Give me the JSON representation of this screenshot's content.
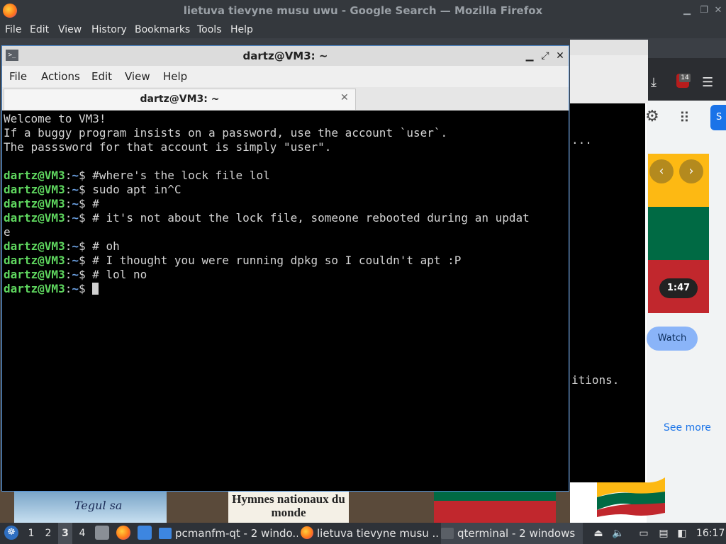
{
  "firefox": {
    "window_title": "lietuva tievyne musu uwu - Google Search — Mozilla Firefox",
    "menu": [
      "File",
      "Edit",
      "View",
      "History",
      "Bookmarks",
      "Tools",
      "Help"
    ],
    "ublock_count": "14",
    "page": {
      "video_duration": "1:47",
      "watch_label": "Watch",
      "see_more_label": "See more",
      "thumb_1_text": "Tegul sa",
      "thumb_2_text": "Hymnes nationaux du monde"
    }
  },
  "terminal_back": {
    "line_1": "...",
    "line_2": "itions."
  },
  "terminal": {
    "window_title": "dartz@VM3: ~",
    "menu": [
      "File",
      "Actions",
      "Edit",
      "View",
      "Help"
    ],
    "tab_label": "dartz@VM3: ~",
    "prompt_user": "dartz@VM3",
    "prompt_path": "~",
    "lines": [
      {
        "type": "text",
        "text": "Welcome to VM3!"
      },
      {
        "type": "text",
        "text": "If a buggy program insists on a password, use the account `user`."
      },
      {
        "type": "text",
        "text": "The passsword for that account is simply \"user\"."
      },
      {
        "type": "text",
        "text": ""
      },
      {
        "type": "prompt",
        "cmd": "#where's the lock file lol"
      },
      {
        "type": "prompt",
        "cmd": "sudo apt in^C"
      },
      {
        "type": "prompt",
        "cmd": "#"
      },
      {
        "type": "prompt",
        "cmd": "# it's not about the lock file, someone rebooted during an updat"
      },
      {
        "type": "text",
        "text": "e"
      },
      {
        "type": "prompt",
        "cmd": "# oh"
      },
      {
        "type": "prompt",
        "cmd": "# I thought you were running dpkg so I couldn't apt :P"
      },
      {
        "type": "prompt",
        "cmd": "# lol no"
      },
      {
        "type": "prompt",
        "cmd": "",
        "cursor": true
      }
    ]
  },
  "taskbar": {
    "desktops": [
      "1",
      "2",
      "3",
      "4"
    ],
    "active_desktop": "3",
    "tasks": [
      {
        "label": "pcmanfm-qt - 2 windo...",
        "icon": "folder-icon"
      },
      {
        "label": "lietuva tievyne musu ...",
        "icon": "firefox-icon"
      },
      {
        "label": "qterminal - 2 windows",
        "icon": "terminal-icon"
      }
    ],
    "clock": "16:17"
  }
}
